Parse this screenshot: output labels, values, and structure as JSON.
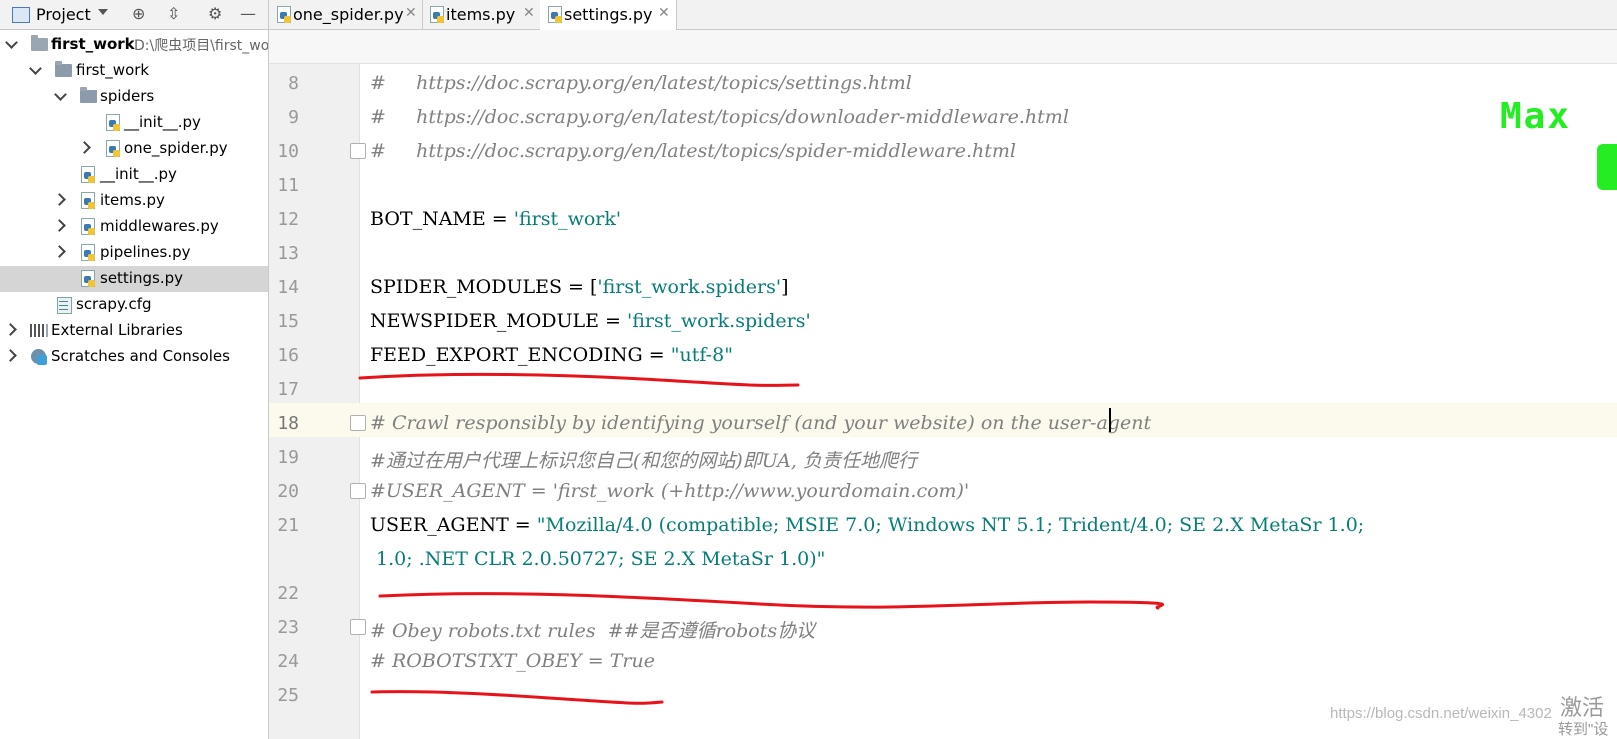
{
  "project_panel": {
    "title": "Project",
    "tree": [
      {
        "label": "first_work",
        "path": "D:\\爬虫项目\\first_wo"
      },
      {
        "label": "first_work"
      },
      {
        "label": "spiders"
      },
      {
        "label": "__init__.py"
      },
      {
        "label": "one_spider.py"
      },
      {
        "label": "__init__.py"
      },
      {
        "label": "items.py"
      },
      {
        "label": "middlewares.py"
      },
      {
        "label": "pipelines.py"
      },
      {
        "label": "settings.py"
      },
      {
        "label": "scrapy.cfg"
      },
      {
        "label": "External Libraries"
      },
      {
        "label": "Scratches and Consoles"
      }
    ]
  },
  "tabs": [
    {
      "label": "one_spider.py"
    },
    {
      "label": "items.py"
    },
    {
      "label": "settings.py",
      "active": true
    }
  ],
  "editor": {
    "lines": [
      {
        "n": "8",
        "t": "#     https://doc.scrapy.org/en/latest/topics/settings.html"
      },
      {
        "n": "9",
        "t": "#     https://doc.scrapy.org/en/latest/topics/downloader-middleware.html"
      },
      {
        "n": "10",
        "t": "#     https://doc.scrapy.org/en/latest/topics/spider-middleware.html"
      },
      {
        "n": "11",
        "t": ""
      },
      {
        "n": "12",
        "a": "BOT_NAME = ",
        "b": "'first_work'"
      },
      {
        "n": "13",
        "t": ""
      },
      {
        "n": "14",
        "a": "SPIDER_MODULES = [",
        "b": "'first_work.spiders'",
        "c": "]"
      },
      {
        "n": "15",
        "a": "NEWSPIDER_MODULE = ",
        "b": "'first_work.spiders'"
      },
      {
        "n": "16",
        "a": "FEED_EXPORT_ENCODING = ",
        "b": "\"utf-8\""
      },
      {
        "n": "17",
        "t": ""
      },
      {
        "n": "18",
        "t": "# Crawl responsibly by identifying yourself (and your website) on the user-agent"
      },
      {
        "n": "19",
        "t": "#通过在用户代理上标识您自己(和您的网站)即UA, 负责任地爬行"
      },
      {
        "n": "20",
        "t": "#USER_AGENT = 'first_work (+http://www.yourdomain.com)'"
      },
      {
        "n": "21",
        "a": "USER_AGENT = ",
        "b": "\"Mozilla/4.0 (compatible; MSIE 7.0; Windows NT 5.1; Trident/4.0; SE 2.X MetaSr 1.0;"
      },
      {
        "n": "",
        "b": " 1.0; .NET CLR 2.0.50727; SE 2.X MetaSr 1.0)\""
      },
      {
        "n": "22",
        "t": ""
      },
      {
        "n": "23",
        "t": "# Obey robots.txt rules  ##是否遵循robots协议"
      },
      {
        "n": "24",
        "t": "# ROBOTSTXT_OBEY = True"
      },
      {
        "n": "25",
        "t": ""
      }
    ]
  },
  "overlay": {
    "max_text": "Max",
    "watermark": "https://blog.csdn.net/weixin_4302",
    "activate": "激活",
    "activate_sub": "转到\"设"
  },
  "colors": {
    "accent_annotation": "#e8121a",
    "string": "#067d17",
    "comment": "#808080"
  }
}
